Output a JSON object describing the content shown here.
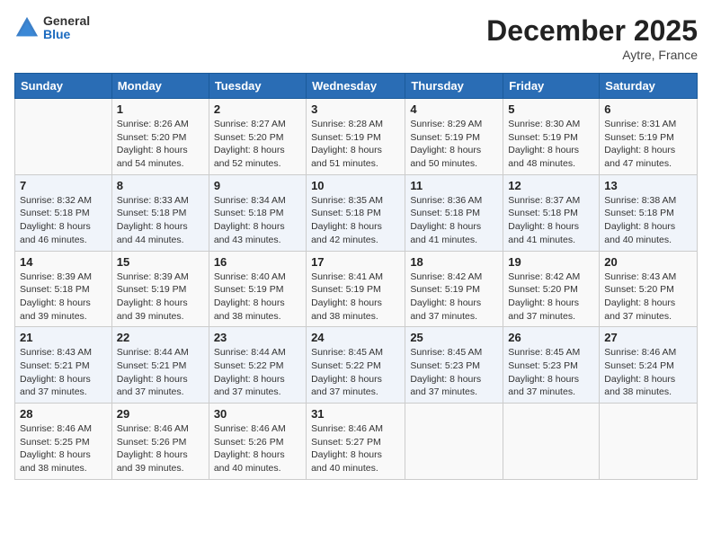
{
  "logo": {
    "general": "General",
    "blue": "Blue"
  },
  "title": "December 2025",
  "location": "Aytre, France",
  "days_header": [
    "Sunday",
    "Monday",
    "Tuesday",
    "Wednesday",
    "Thursday",
    "Friday",
    "Saturday"
  ],
  "weeks": [
    [
      {
        "num": "",
        "info": ""
      },
      {
        "num": "1",
        "info": "Sunrise: 8:26 AM\nSunset: 5:20 PM\nDaylight: 8 hours\nand 54 minutes."
      },
      {
        "num": "2",
        "info": "Sunrise: 8:27 AM\nSunset: 5:20 PM\nDaylight: 8 hours\nand 52 minutes."
      },
      {
        "num": "3",
        "info": "Sunrise: 8:28 AM\nSunset: 5:19 PM\nDaylight: 8 hours\nand 51 minutes."
      },
      {
        "num": "4",
        "info": "Sunrise: 8:29 AM\nSunset: 5:19 PM\nDaylight: 8 hours\nand 50 minutes."
      },
      {
        "num": "5",
        "info": "Sunrise: 8:30 AM\nSunset: 5:19 PM\nDaylight: 8 hours\nand 48 minutes."
      },
      {
        "num": "6",
        "info": "Sunrise: 8:31 AM\nSunset: 5:19 PM\nDaylight: 8 hours\nand 47 minutes."
      }
    ],
    [
      {
        "num": "7",
        "info": "Sunrise: 8:32 AM\nSunset: 5:18 PM\nDaylight: 8 hours\nand 46 minutes."
      },
      {
        "num": "8",
        "info": "Sunrise: 8:33 AM\nSunset: 5:18 PM\nDaylight: 8 hours\nand 44 minutes."
      },
      {
        "num": "9",
        "info": "Sunrise: 8:34 AM\nSunset: 5:18 PM\nDaylight: 8 hours\nand 43 minutes."
      },
      {
        "num": "10",
        "info": "Sunrise: 8:35 AM\nSunset: 5:18 PM\nDaylight: 8 hours\nand 42 minutes."
      },
      {
        "num": "11",
        "info": "Sunrise: 8:36 AM\nSunset: 5:18 PM\nDaylight: 8 hours\nand 41 minutes."
      },
      {
        "num": "12",
        "info": "Sunrise: 8:37 AM\nSunset: 5:18 PM\nDaylight: 8 hours\nand 41 minutes."
      },
      {
        "num": "13",
        "info": "Sunrise: 8:38 AM\nSunset: 5:18 PM\nDaylight: 8 hours\nand 40 minutes."
      }
    ],
    [
      {
        "num": "14",
        "info": "Sunrise: 8:39 AM\nSunset: 5:18 PM\nDaylight: 8 hours\nand 39 minutes."
      },
      {
        "num": "15",
        "info": "Sunrise: 8:39 AM\nSunset: 5:19 PM\nDaylight: 8 hours\nand 39 minutes."
      },
      {
        "num": "16",
        "info": "Sunrise: 8:40 AM\nSunset: 5:19 PM\nDaylight: 8 hours\nand 38 minutes."
      },
      {
        "num": "17",
        "info": "Sunrise: 8:41 AM\nSunset: 5:19 PM\nDaylight: 8 hours\nand 38 minutes."
      },
      {
        "num": "18",
        "info": "Sunrise: 8:42 AM\nSunset: 5:19 PM\nDaylight: 8 hours\nand 37 minutes."
      },
      {
        "num": "19",
        "info": "Sunrise: 8:42 AM\nSunset: 5:20 PM\nDaylight: 8 hours\nand 37 minutes."
      },
      {
        "num": "20",
        "info": "Sunrise: 8:43 AM\nSunset: 5:20 PM\nDaylight: 8 hours\nand 37 minutes."
      }
    ],
    [
      {
        "num": "21",
        "info": "Sunrise: 8:43 AM\nSunset: 5:21 PM\nDaylight: 8 hours\nand 37 minutes."
      },
      {
        "num": "22",
        "info": "Sunrise: 8:44 AM\nSunset: 5:21 PM\nDaylight: 8 hours\nand 37 minutes."
      },
      {
        "num": "23",
        "info": "Sunrise: 8:44 AM\nSunset: 5:22 PM\nDaylight: 8 hours\nand 37 minutes."
      },
      {
        "num": "24",
        "info": "Sunrise: 8:45 AM\nSunset: 5:22 PM\nDaylight: 8 hours\nand 37 minutes."
      },
      {
        "num": "25",
        "info": "Sunrise: 8:45 AM\nSunset: 5:23 PM\nDaylight: 8 hours\nand 37 minutes."
      },
      {
        "num": "26",
        "info": "Sunrise: 8:45 AM\nSunset: 5:23 PM\nDaylight: 8 hours\nand 37 minutes."
      },
      {
        "num": "27",
        "info": "Sunrise: 8:46 AM\nSunset: 5:24 PM\nDaylight: 8 hours\nand 38 minutes."
      }
    ],
    [
      {
        "num": "28",
        "info": "Sunrise: 8:46 AM\nSunset: 5:25 PM\nDaylight: 8 hours\nand 38 minutes."
      },
      {
        "num": "29",
        "info": "Sunrise: 8:46 AM\nSunset: 5:26 PM\nDaylight: 8 hours\nand 39 minutes."
      },
      {
        "num": "30",
        "info": "Sunrise: 8:46 AM\nSunset: 5:26 PM\nDaylight: 8 hours\nand 40 minutes."
      },
      {
        "num": "31",
        "info": "Sunrise: 8:46 AM\nSunset: 5:27 PM\nDaylight: 8 hours\nand 40 minutes."
      },
      {
        "num": "",
        "info": ""
      },
      {
        "num": "",
        "info": ""
      },
      {
        "num": "",
        "info": ""
      }
    ]
  ]
}
